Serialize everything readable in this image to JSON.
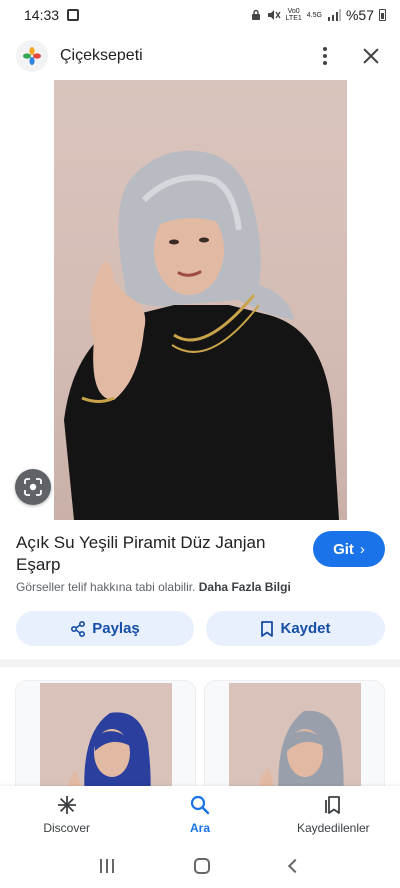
{
  "status_bar": {
    "time": "14:33",
    "network_top": "Vo0",
    "network_bottom": "LTE1",
    "network_speed": "4.5G",
    "battery": "%57"
  },
  "site": {
    "name": "Çiçeksepeti"
  },
  "product": {
    "title": "Açık Su Yeşili Piramit Düz Janjan Eşarp",
    "go_label": "Git",
    "go_chevron": "›",
    "copyright_text": "Görseller telif hakkına tabi olabilir.",
    "more_info": "Daha Fazla Bilgi"
  },
  "actions": {
    "share_label": "Paylaş",
    "save_label": "Kaydet"
  },
  "bottom_nav": {
    "items": [
      {
        "label": "Discover",
        "icon": "asterisk-icon",
        "active": false
      },
      {
        "label": "Ara",
        "icon": "search-icon",
        "active": true
      },
      {
        "label": "Kaydedilenler",
        "icon": "bookmarks-icon",
        "active": false
      }
    ]
  },
  "colors": {
    "accent": "#1a73e8",
    "tonal_button": "#e8f0fe",
    "tonal_text": "#174ea6"
  }
}
